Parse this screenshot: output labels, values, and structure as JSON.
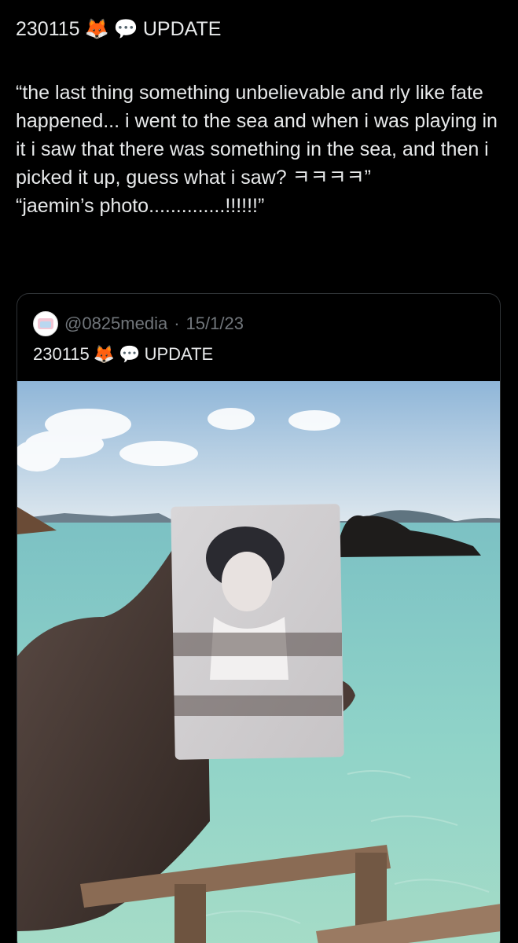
{
  "post": {
    "header_date": "230115",
    "header_emoji_fox": "🦊",
    "header_emoji_speech": "💬",
    "header_label": "UPDATE",
    "lines": [
      "“the last thing something unbelievable and rly like fate happened... i went to the sea and when i was playing in it i saw that there was something in the sea, and then i picked it up, guess what i saw? ㅋㅋㅋㅋ”",
      "“jaemin’s photo..............!!!!!!”"
    ]
  },
  "quote": {
    "handle": "@0825media",
    "separator": "·",
    "date": "15/1/23",
    "title_date": "230115",
    "title_emoji_fox": "🦊",
    "title_emoji_speech": "💬",
    "title_label": "UPDATE",
    "image_icon": "photo-of-hand-holding-portrait-photo-by-sea"
  },
  "colors": {
    "background": "#000000",
    "text": "#e7e9ea",
    "muted": "#71767b",
    "border": "#2f3336"
  }
}
